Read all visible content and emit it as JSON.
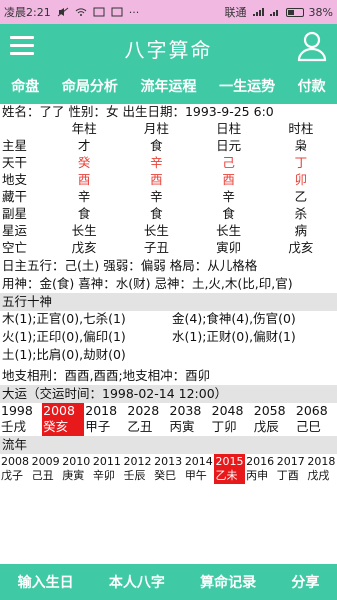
{
  "status": {
    "time": "凌晨2:21",
    "carrier": "联通",
    "battery": "38%"
  },
  "header": {
    "title": "八字算命"
  },
  "tabs": [
    "命盘",
    "命局分析",
    "流年运程",
    "一生运势",
    "付款"
  ],
  "info": {
    "line": "姓名：了了  性别：女  出生日期：1993-9-25 6:0"
  },
  "pillars": {
    "headers": [
      "",
      "年柱",
      "月柱",
      "日柱",
      "时柱"
    ],
    "rows": [
      {
        "label": "主星",
        "cells": [
          "才",
          "食",
          "日元",
          "枭"
        ]
      },
      {
        "label": "天干",
        "cells": [
          "癸",
          "辛",
          "己",
          "丁"
        ]
      },
      {
        "label": "地支",
        "cells": [
          "酉",
          "酉",
          "酉",
          "卯"
        ]
      },
      {
        "label": "藏干",
        "cells": [
          "辛",
          "辛",
          "辛",
          "乙"
        ]
      },
      {
        "label": "副星",
        "cells": [
          "食",
          "食",
          "食",
          "杀"
        ]
      },
      {
        "label": "星运",
        "cells": [
          "长生",
          "长生",
          "长生",
          "病"
        ]
      },
      {
        "label": "空亡",
        "cells": [
          "戊亥",
          "子丑",
          "寅卯",
          "戊亥"
        ]
      }
    ]
  },
  "summary": {
    "line1": "日主五行：己(土)  强弱：偏弱  格局：从儿格格",
    "line2": "用神：金(食) 喜神：水(财) 忌神：土,火,木(比,印,官)"
  },
  "wuxing": {
    "title": "五行十神",
    "rows": [
      [
        "木(1);正官(0),七杀(1)",
        "金(4);食神(4),伤官(0)"
      ],
      [
        "火(1);正印(0),偏印(1)",
        "水(1);正财(0),偏财(1)"
      ],
      [
        "土(1);比肩(0),劫财(0)",
        ""
      ]
    ],
    "relations": "地支相刑：酉酉,酉酉;地支相冲：酉卯"
  },
  "dayun": {
    "title": "大运（交运时间：1998-02-14 12:00）",
    "years": [
      "1998",
      "2008",
      "2018",
      "2028",
      "2038",
      "2048",
      "2058",
      "2068"
    ],
    "ganzhi": [
      "壬戌",
      "癸亥",
      "甲子",
      "乙丑",
      "丙寅",
      "丁卯",
      "戊辰",
      "己巳"
    ]
  },
  "liunian": {
    "title": "流年",
    "years": [
      "2008",
      "2009",
      "2010",
      "2011",
      "2012",
      "2013",
      "2014",
      "2015",
      "2016",
      "2017",
      "2018"
    ],
    "ganzhi": [
      "戊子",
      "己丑",
      "庚寅",
      "辛卯",
      "壬辰",
      "癸巳",
      "甲午",
      "乙未",
      "丙申",
      "丁酉",
      "戊戌"
    ]
  },
  "bottom": [
    "输入生日",
    "本人八字",
    "算命记录",
    "分享"
  ]
}
